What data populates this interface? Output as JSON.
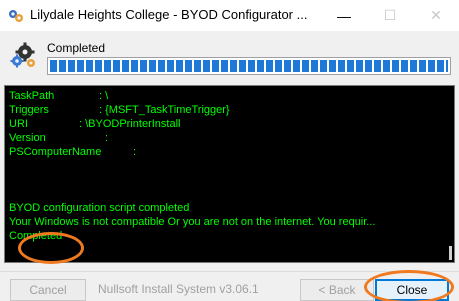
{
  "window": {
    "title": "Lilydale Heights College - BYOD Configurator ...",
    "minimize_glyph": "—",
    "maximize_glyph": "☐",
    "close_glyph": "✕",
    "app_icon": "installer-gear-icon"
  },
  "status": {
    "text": "Completed",
    "icon": "gears-icon",
    "progress_percent": 100
  },
  "log": {
    "lines": [
      {
        "key": "TaskPath",
        "value": ": \\"
      },
      {
        "key": "Triggers",
        "value": ": {MSFT_TaskTimeTrigger}"
      },
      {
        "key": "URI",
        "value": ": \\BYODPrinterInstall"
      },
      {
        "key": "Version",
        "value": ":"
      },
      {
        "key": "PSComputerName",
        "value": ":"
      },
      {
        "key": "",
        "value": ""
      },
      {
        "key": "",
        "value": ""
      },
      {
        "key": "",
        "value": ""
      },
      {
        "key": "BYOD configuration script completed",
        "value": ""
      },
      {
        "key": "Your Windows is not compatible Or you are not on the internet. You requir...",
        "value": ""
      },
      {
        "key": "Completed",
        "value": ""
      }
    ]
  },
  "footer": {
    "cancel_label": "Cancel",
    "branding": "Nullsoft Install System v3.06.1",
    "back_label": "< Back",
    "close_label": "Close"
  },
  "colors": {
    "log_text": "#00ff00",
    "progress": "#1e78d8",
    "highlight": "#f07a20"
  }
}
